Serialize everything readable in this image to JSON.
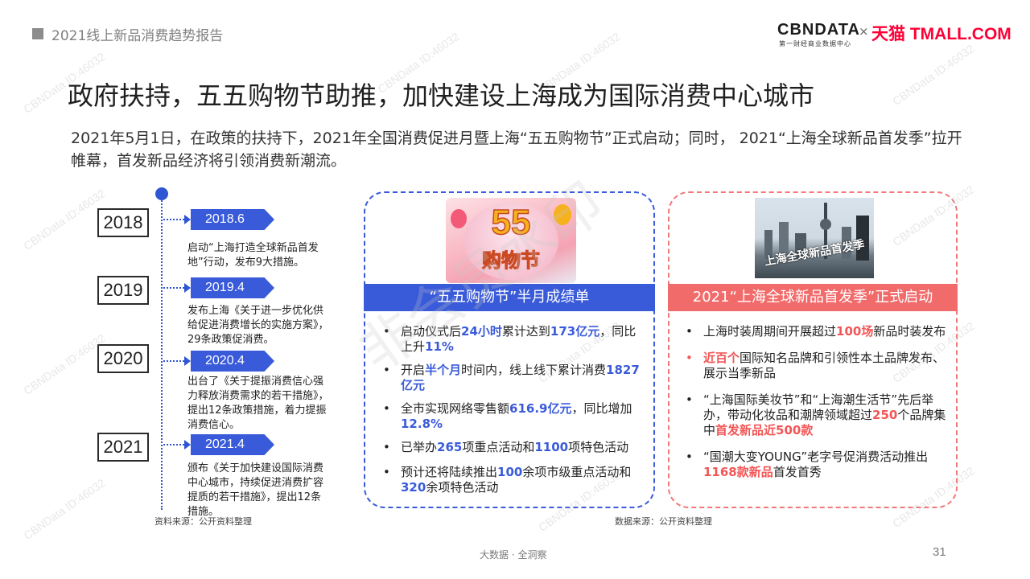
{
  "header": {
    "report_title": "2021线上新品消费趋势报告",
    "logo_cbndata": "CBNDATA",
    "logo_cbndata_sub": "第一财经商业数据中心",
    "logo_separator": "×",
    "logo_tmall": "天猫 TMALL.COM"
  },
  "title": "政府扶持，五五购物节助推，加快建设上海成为国际消费中心城市",
  "intro": "2021年5月1日，在政策的扶持下，2021年全国消费促进月暨上海“五五购物节”正式启动；同时， 2021“上海全球新品首发季”拉开帷幕，首发新品经济将引领消费新潮流。",
  "timeline": [
    {
      "year": "2018",
      "date": "2018.6",
      "event": [
        "启动“上海打造全球新品首发",
        "地”行动，发布9大措施。"
      ]
    },
    {
      "year": "2019",
      "date": "2019.4",
      "event": [
        "发布上海《关于进一步优化供",
        "给促进消费增长的实施方案》，",
        "29条政策促消费。"
      ]
    },
    {
      "year": "2020",
      "date": "2020.4",
      "event": [
        "出台了《关于提振消费信心强",
        "力释放消费需求的若干措施》，",
        "提出12条政策措施，着力提振",
        "消费信心。"
      ]
    },
    {
      "year": "2021",
      "date": "2021.4",
      "event": [
        "颁布《关于加快建设国际消费",
        "中心城市，持续促进消费扩容",
        "提质的若干措施》，提出12条",
        "措施。"
      ]
    }
  ],
  "sources": {
    "left": "资料来源：公开资料整理",
    "right": "数据来源：公开资料整理"
  },
  "card_left": {
    "image": {
      "number": "55",
      "label": "购物节"
    },
    "header": "“五五购物节”半月成绩单",
    "items": [
      {
        "bullet": "•",
        "p1": "启动仪式后",
        "h1": "24小时",
        "p2": "累计达到",
        "h2": "173亿元",
        "p3": "，同比上升",
        "h3": "11%"
      },
      {
        "bullet": "•",
        "p1": "开启",
        "h1": "半个月",
        "p2": "时间内，线上线下累计消费",
        "h2": "1827亿元",
        "p3": "",
        "h3": ""
      },
      {
        "bullet": "•",
        "p1": "全市实现网络零售额",
        "h1": "616.9亿元",
        "p2": "，同比增加",
        "h2": "12.8%",
        "p3": "",
        "h3": ""
      },
      {
        "bullet": "•",
        "p1": "已举办",
        "h1": "265",
        "p2": "项重点活动和",
        "h2": "1100",
        "p3": "项特色活动",
        "h3": ""
      },
      {
        "bullet": "•",
        "p1": "预计还将陆续推出",
        "h1": "100",
        "p2": "余项市级重点活动和",
        "h2": "320",
        "p3": "余项特色活动",
        "h3": ""
      }
    ]
  },
  "card_right": {
    "image": {
      "caption": "上海全球新品首发季"
    },
    "header": "2021“上海全球新品首发季”正式启动",
    "items": [
      {
        "bullet": "•",
        "p1": "上海时装周期间开展超过",
        "h1": "100场",
        "p2": "新品时装发布",
        "h2": "",
        "p3": "",
        "h3": ""
      },
      {
        "bullet": "•",
        "p1": "",
        "h1": "近百个",
        "p2": "国际知名品牌和引领性本土品牌发布、展示当季新品",
        "h2": "",
        "p3": "",
        "h3": ""
      },
      {
        "bullet": "•",
        "p1": "“上海国际美妆节”和“上海潮生活节”先后举办，带动化妆品和潮牌领域超过",
        "h1": "250",
        "p2": "个品牌集中",
        "h2": "首发新品近500款",
        "p3": "",
        "h3": ""
      },
      {
        "bullet": "•",
        "p1": "“国潮大变YOUNG”老字号促消费活动推出",
        "h1": "1168款新品",
        "p2": "首发首秀",
        "h2": "",
        "p3": "",
        "h3": ""
      }
    ]
  },
  "footer": {
    "center": "大数据 · 全洞察",
    "page": "31"
  },
  "watermark": {
    "small": "CBNData ID:46032",
    "big": "非会员水印"
  },
  "colors": {
    "accent_blue": "#3a5bd9",
    "accent_red": "#f26b6b",
    "tmall_red": "#ff0036"
  }
}
